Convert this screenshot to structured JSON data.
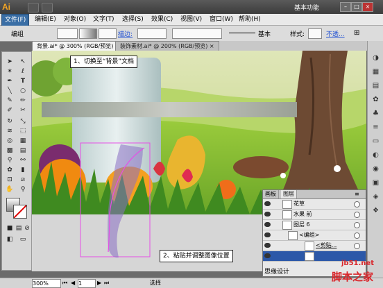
{
  "app": {
    "logo": "Ai",
    "workspace": "基本功能",
    "window_buttons": [
      "–",
      "□",
      "×"
    ]
  },
  "menu": [
    "文件(F)",
    "编辑(E)",
    "对象(O)",
    "文字(T)",
    "选择(S)",
    "效果(C)",
    "视图(V)",
    "窗口(W)",
    "帮助(H)"
  ],
  "control": {
    "group_label": "编组",
    "stroke_label": "描边:",
    "style_label": "基本",
    "style_text": "样式:",
    "opacity_label": "不透..."
  },
  "tabs": [
    {
      "label": "背景.ai* @ 300% (RGB/预览)",
      "close": "×"
    },
    {
      "label": "装饰素材.ai* @ 200% (RGB/预览)",
      "close": "×"
    }
  ],
  "callouts": {
    "step1": "1、切换至“背景”文档",
    "step2": "2、粘贴并调整图像位置"
  },
  "layers_panel": {
    "tabs": [
      "画板",
      "图层"
    ],
    "rows": [
      {
        "name": "花草"
      },
      {
        "name": "水果 前"
      },
      {
        "name": "图层 6"
      },
      {
        "name": "<编组>"
      },
      {
        "name": "<剪贴..."
      },
      {
        "name": ""
      }
    ],
    "footer": "思缘设计"
  },
  "status": {
    "zoom": "300%",
    "page": "1",
    "mode": "选择"
  },
  "watermark": {
    "site": "jb51.net",
    "name": "脚本之家"
  },
  "colors": {
    "accent": "#3a6ea5",
    "selection": "#e64fe6"
  }
}
